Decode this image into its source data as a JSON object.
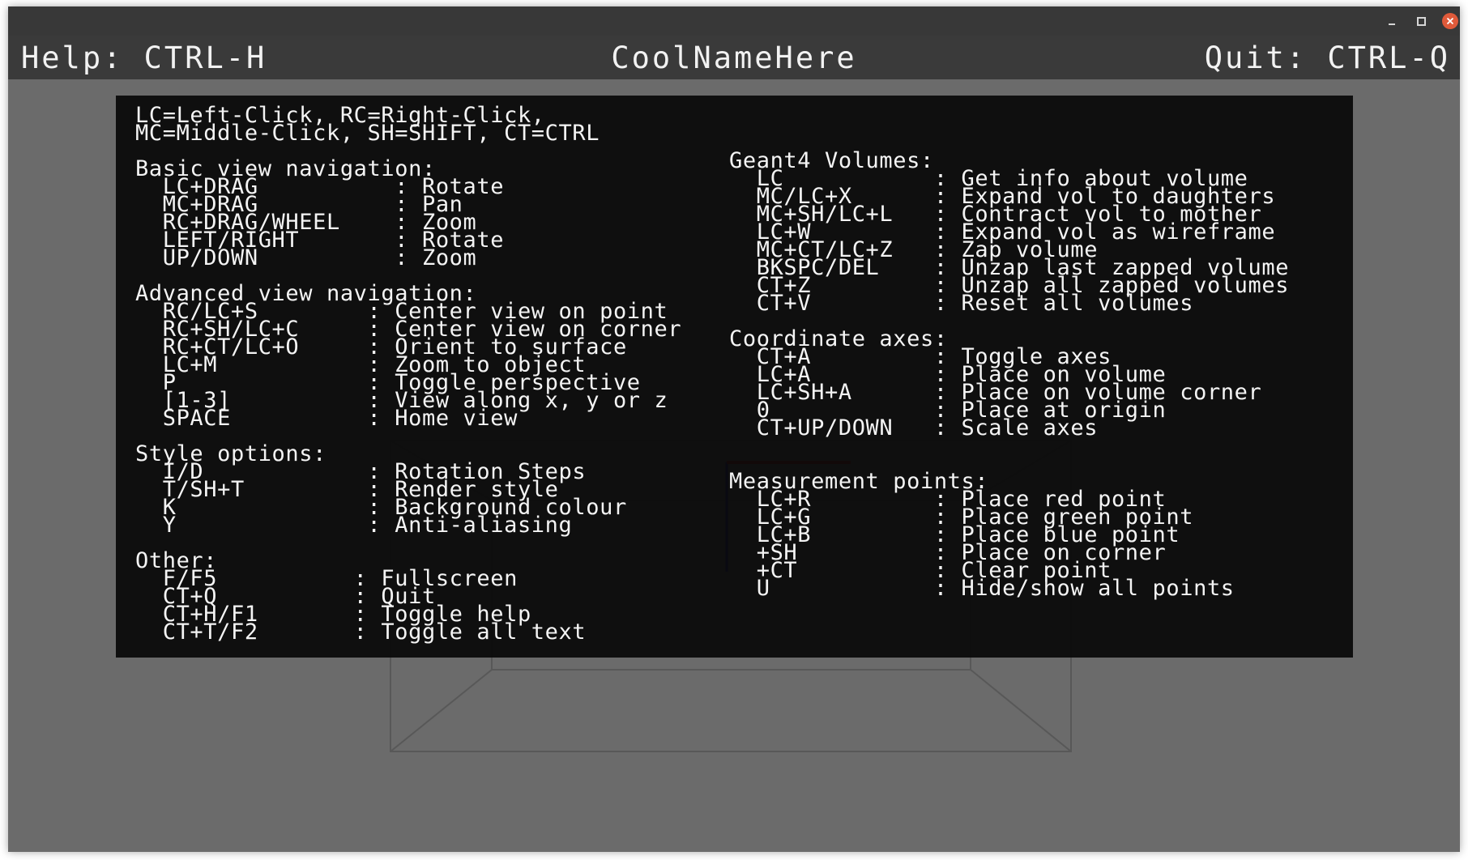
{
  "header": {
    "help_hint": "Help: CTRL-H",
    "title": "CoolNameHere",
    "quit_hint": "Quit: CTRL-Q"
  },
  "help": {
    "intro": [
      "LC=Left-Click, RC=Right-Click,",
      "MC=Middle-Click, SH=SHIFT, CT=CTRL"
    ],
    "basic": {
      "title": "Basic view navigation:",
      "items": [
        "  LC+DRAG          : Rotate",
        "  MC+DRAG          : Pan",
        "  RC+DRAG/WHEEL    : Zoom",
        "  LEFT/RIGHT       : Rotate",
        "  UP/DOWN          : Zoom"
      ]
    },
    "advanced": {
      "title": "Advanced view navigation:",
      "items": [
        "  RC/LC+S        : Center view on point",
        "  RC+SH/LC+C     : Center view on corner",
        "  RC+CT/LC+O     : Orient to surface",
        "  LC+M           : Zoom to object",
        "  P              : Toggle perspective",
        "  [1-3]          : View along x, y or z",
        "  SPACE          : Home view"
      ]
    },
    "style": {
      "title": "Style options:",
      "items": [
        "  I/D            : Rotation Steps",
        "  T/SH+T         : Render style",
        "  K              : Background colour",
        "  Y              : Anti-aliasing"
      ]
    },
    "other": {
      "title": "Other:",
      "items": [
        "  F/F5          : Fullscreen",
        "  CT+Q          : Quit",
        "  CT+H/F1       : Toggle help",
        "  CT+T/F2       : Toggle all text"
      ]
    },
    "volumes": {
      "title": "Geant4 Volumes:",
      "items": [
        "  LC           : Get info about volume",
        "  MC/LC+X      : Expand vol to daughters",
        "  MC+SH/LC+L   : Contract vol to mother",
        "  LC+W         : Expand vol as wireframe",
        "  MC+CT/LC+Z   : Zap volume",
        "  BKSPC/DEL    : Unzap last zapped volume",
        "  CT+Z         : Unzap all zapped volumes",
        "  CT+V         : Reset all volumes"
      ]
    },
    "axes": {
      "title": "Coordinate axes:",
      "items": [
        "  CT+A         : Toggle axes",
        "  LC+A         : Place on volume",
        "  LC+SH+A      : Place on volume corner",
        "  0            : Place at origin",
        "  CT+UP/DOWN   : Scale axes"
      ]
    },
    "measure": {
      "title": "Measurement points:",
      "items": [
        "  LC+R         : Place red point",
        "  LC+G         : Place green point",
        "  LC+B         : Place blue point",
        "  +SH          : Place on corner",
        "  +CT          : Clear point",
        "  U            : Hide/show all points"
      ]
    }
  }
}
